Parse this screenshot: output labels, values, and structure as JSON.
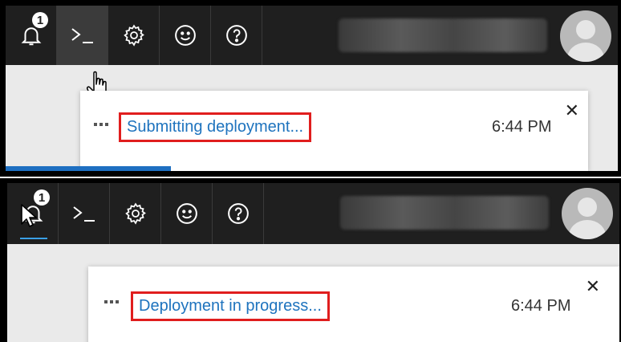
{
  "colors": {
    "toolbar_bg": "#1f1f1f",
    "active_button_bg": "#3b3b3b",
    "link": "#1e73be",
    "highlight_box": "#e01e1e",
    "progress": "#1e6fc1",
    "underline": "#3aa0e6"
  },
  "top_panel": {
    "toolbar": {
      "items": [
        {
          "name": "notifications",
          "icon": "bell-icon",
          "badge": "1"
        },
        {
          "name": "cloud-shell",
          "icon": "terminal-icon",
          "active": true
        },
        {
          "name": "settings",
          "icon": "gear-icon"
        },
        {
          "name": "feedback",
          "icon": "smiley-icon"
        },
        {
          "name": "help",
          "icon": "question-icon"
        }
      ]
    },
    "notification": {
      "message": "Submitting deployment...",
      "time": "6:44 PM",
      "close_glyph": "✕"
    },
    "progress_fraction": 0.27
  },
  "bottom_panel": {
    "toolbar": {
      "items": [
        {
          "name": "notifications",
          "icon": "bell-icon",
          "badge": "1",
          "selected": true
        },
        {
          "name": "cloud-shell",
          "icon": "terminal-icon"
        },
        {
          "name": "settings",
          "icon": "gear-icon"
        },
        {
          "name": "feedback",
          "icon": "smiley-icon"
        },
        {
          "name": "help",
          "icon": "question-icon"
        }
      ]
    },
    "notification": {
      "message": "Deployment in progress...",
      "time": "6:44 PM",
      "close_glyph": "✕"
    }
  }
}
